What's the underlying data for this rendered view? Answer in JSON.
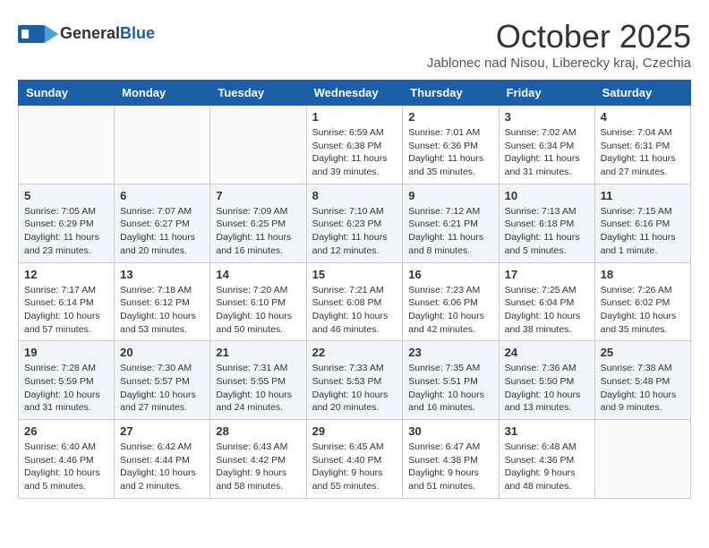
{
  "header": {
    "logo_general": "General",
    "logo_blue": "Blue",
    "month_title": "October 2025",
    "subtitle": "Jablonec nad Nisou, Liberecky kraj, Czechia"
  },
  "days_of_week": [
    "Sunday",
    "Monday",
    "Tuesday",
    "Wednesday",
    "Thursday",
    "Friday",
    "Saturday"
  ],
  "weeks": [
    [
      {
        "day": "",
        "info": ""
      },
      {
        "day": "",
        "info": ""
      },
      {
        "day": "",
        "info": ""
      },
      {
        "day": "1",
        "info": "Sunrise: 6:59 AM\nSunset: 6:38 PM\nDaylight: 11 hours\nand 39 minutes."
      },
      {
        "day": "2",
        "info": "Sunrise: 7:01 AM\nSunset: 6:36 PM\nDaylight: 11 hours\nand 35 minutes."
      },
      {
        "day": "3",
        "info": "Sunrise: 7:02 AM\nSunset: 6:34 PM\nDaylight: 11 hours\nand 31 minutes."
      },
      {
        "day": "4",
        "info": "Sunrise: 7:04 AM\nSunset: 6:31 PM\nDaylight: 11 hours\nand 27 minutes."
      }
    ],
    [
      {
        "day": "5",
        "info": "Sunrise: 7:05 AM\nSunset: 6:29 PM\nDaylight: 11 hours\nand 23 minutes."
      },
      {
        "day": "6",
        "info": "Sunrise: 7:07 AM\nSunset: 6:27 PM\nDaylight: 11 hours\nand 20 minutes."
      },
      {
        "day": "7",
        "info": "Sunrise: 7:09 AM\nSunset: 6:25 PM\nDaylight: 11 hours\nand 16 minutes."
      },
      {
        "day": "8",
        "info": "Sunrise: 7:10 AM\nSunset: 6:23 PM\nDaylight: 11 hours\nand 12 minutes."
      },
      {
        "day": "9",
        "info": "Sunrise: 7:12 AM\nSunset: 6:21 PM\nDaylight: 11 hours\nand 8 minutes."
      },
      {
        "day": "10",
        "info": "Sunrise: 7:13 AM\nSunset: 6:18 PM\nDaylight: 11 hours\nand 5 minutes."
      },
      {
        "day": "11",
        "info": "Sunrise: 7:15 AM\nSunset: 6:16 PM\nDaylight: 11 hours\nand 1 minute."
      }
    ],
    [
      {
        "day": "12",
        "info": "Sunrise: 7:17 AM\nSunset: 6:14 PM\nDaylight: 10 hours\nand 57 minutes."
      },
      {
        "day": "13",
        "info": "Sunrise: 7:18 AM\nSunset: 6:12 PM\nDaylight: 10 hours\nand 53 minutes."
      },
      {
        "day": "14",
        "info": "Sunrise: 7:20 AM\nSunset: 6:10 PM\nDaylight: 10 hours\nand 50 minutes."
      },
      {
        "day": "15",
        "info": "Sunrise: 7:21 AM\nSunset: 6:08 PM\nDaylight: 10 hours\nand 46 minutes."
      },
      {
        "day": "16",
        "info": "Sunrise: 7:23 AM\nSunset: 6:06 PM\nDaylight: 10 hours\nand 42 minutes."
      },
      {
        "day": "17",
        "info": "Sunrise: 7:25 AM\nSunset: 6:04 PM\nDaylight: 10 hours\nand 38 minutes."
      },
      {
        "day": "18",
        "info": "Sunrise: 7:26 AM\nSunset: 6:02 PM\nDaylight: 10 hours\nand 35 minutes."
      }
    ],
    [
      {
        "day": "19",
        "info": "Sunrise: 7:28 AM\nSunset: 5:59 PM\nDaylight: 10 hours\nand 31 minutes."
      },
      {
        "day": "20",
        "info": "Sunrise: 7:30 AM\nSunset: 5:57 PM\nDaylight: 10 hours\nand 27 minutes."
      },
      {
        "day": "21",
        "info": "Sunrise: 7:31 AM\nSunset: 5:55 PM\nDaylight: 10 hours\nand 24 minutes."
      },
      {
        "day": "22",
        "info": "Sunrise: 7:33 AM\nSunset: 5:53 PM\nDaylight: 10 hours\nand 20 minutes."
      },
      {
        "day": "23",
        "info": "Sunrise: 7:35 AM\nSunset: 5:51 PM\nDaylight: 10 hours\nand 16 minutes."
      },
      {
        "day": "24",
        "info": "Sunrise: 7:36 AM\nSunset: 5:50 PM\nDaylight: 10 hours\nand 13 minutes."
      },
      {
        "day": "25",
        "info": "Sunrise: 7:38 AM\nSunset: 5:48 PM\nDaylight: 10 hours\nand 9 minutes."
      }
    ],
    [
      {
        "day": "26",
        "info": "Sunrise: 6:40 AM\nSunset: 4:46 PM\nDaylight: 10 hours\nand 5 minutes."
      },
      {
        "day": "27",
        "info": "Sunrise: 6:42 AM\nSunset: 4:44 PM\nDaylight: 10 hours\nand 2 minutes."
      },
      {
        "day": "28",
        "info": "Sunrise: 6:43 AM\nSunset: 4:42 PM\nDaylight: 9 hours\nand 58 minutes."
      },
      {
        "day": "29",
        "info": "Sunrise: 6:45 AM\nSunset: 4:40 PM\nDaylight: 9 hours\nand 55 minutes."
      },
      {
        "day": "30",
        "info": "Sunrise: 6:47 AM\nSunset: 4:38 PM\nDaylight: 9 hours\nand 51 minutes."
      },
      {
        "day": "31",
        "info": "Sunrise: 6:48 AM\nSunset: 4:36 PM\nDaylight: 9 hours\nand 48 minutes."
      },
      {
        "day": "",
        "info": ""
      }
    ]
  ]
}
